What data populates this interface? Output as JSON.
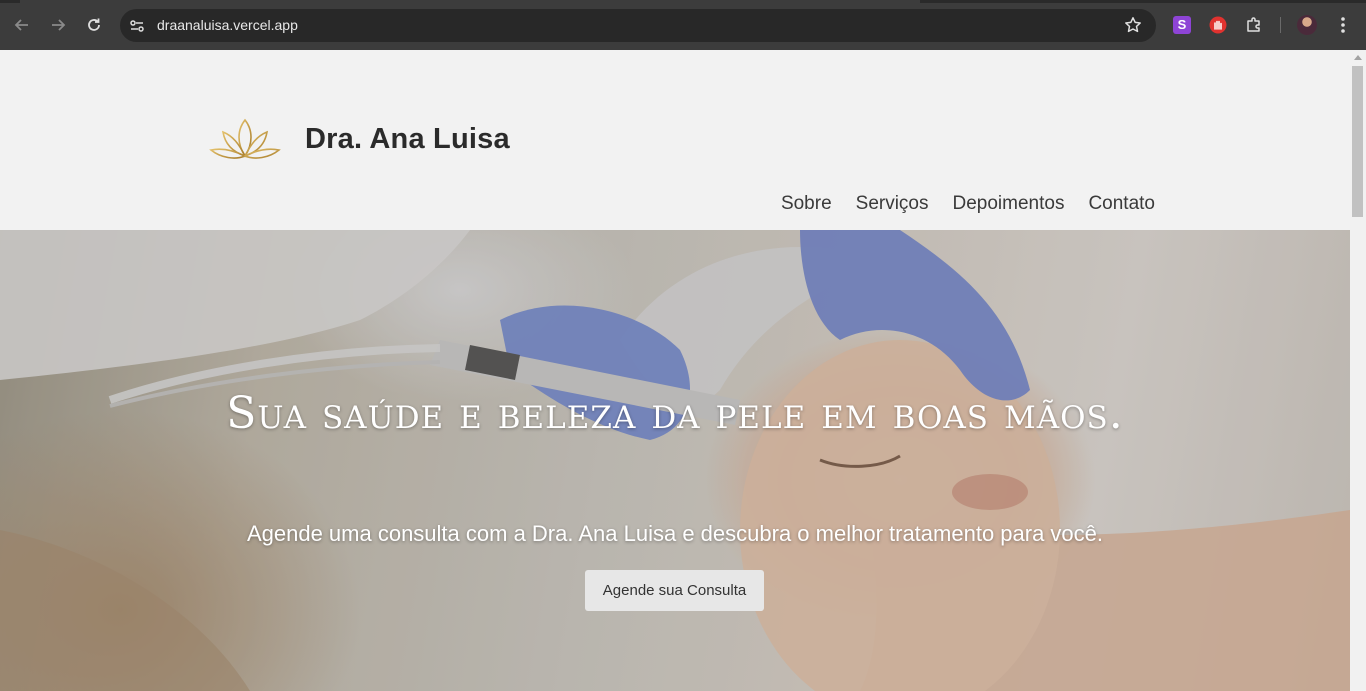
{
  "browser": {
    "url": "draanaluisa.vercel.app",
    "extension_s_label": "S",
    "icons": [
      "back-arrow-icon",
      "forward-arrow-icon",
      "reload-icon",
      "site-settings-icon",
      "bookmark-star-icon",
      "extension-s-icon",
      "extension-hand-icon",
      "extensions-puzzle-icon",
      "profile-avatar",
      "menu-dots-icon"
    ]
  },
  "header": {
    "brand": "Dra. Ana Luisa",
    "logo_icon": "lotus-icon",
    "logo_color": "#c9a24a",
    "nav": [
      {
        "label": "Sobre"
      },
      {
        "label": "Serviços"
      },
      {
        "label": "Depoimentos"
      },
      {
        "label": "Contato"
      }
    ]
  },
  "hero": {
    "title": "Sua saúde e beleza da pele em boas mãos.",
    "subtitle": "Agende uma consulta com a Dra. Ana Luisa e descubra o melhor tratamento para você.",
    "cta_label": "Agende sua Consulta"
  },
  "colors": {
    "chrome": "#3c3c3c",
    "omnibox": "#282828",
    "page_bg": "#f2f2f2",
    "cta_bg": "#e7e7e7"
  }
}
